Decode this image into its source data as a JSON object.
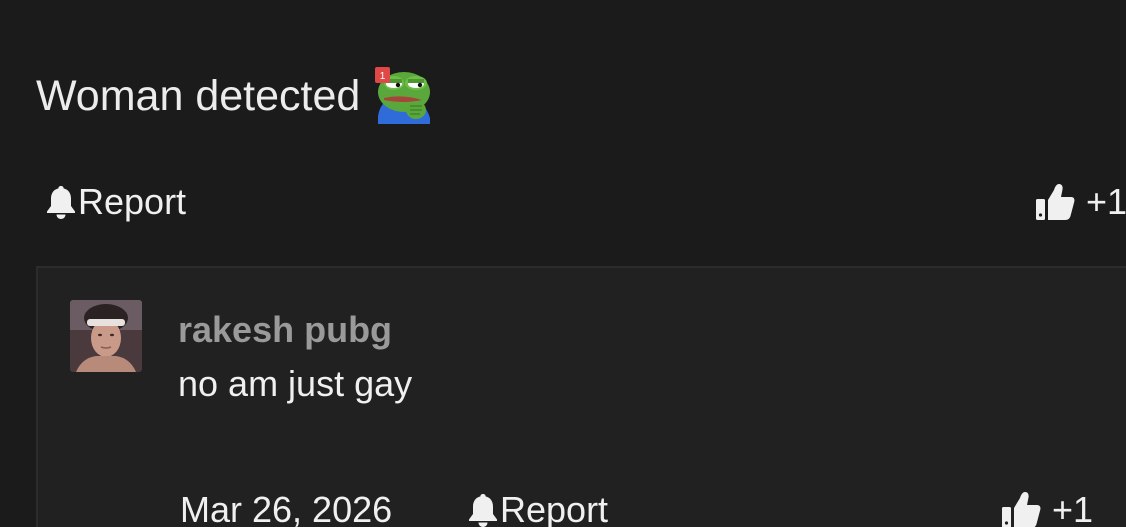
{
  "post": {
    "text": "Woman detected",
    "emoji_name": "pepe-frog-emoji",
    "emoji_badge": "1",
    "report_label": "Report",
    "like_count": "+1"
  },
  "reply": {
    "author": "rakesh pubg",
    "body": "no am just gay",
    "date": "Mar 26, 2026",
    "report_label": "Report",
    "like_count": "+1"
  },
  "colors": {
    "background": "#1b1b1b",
    "reply_background": "#212121",
    "text": "#ececec",
    "author": "#9a9a9a"
  }
}
